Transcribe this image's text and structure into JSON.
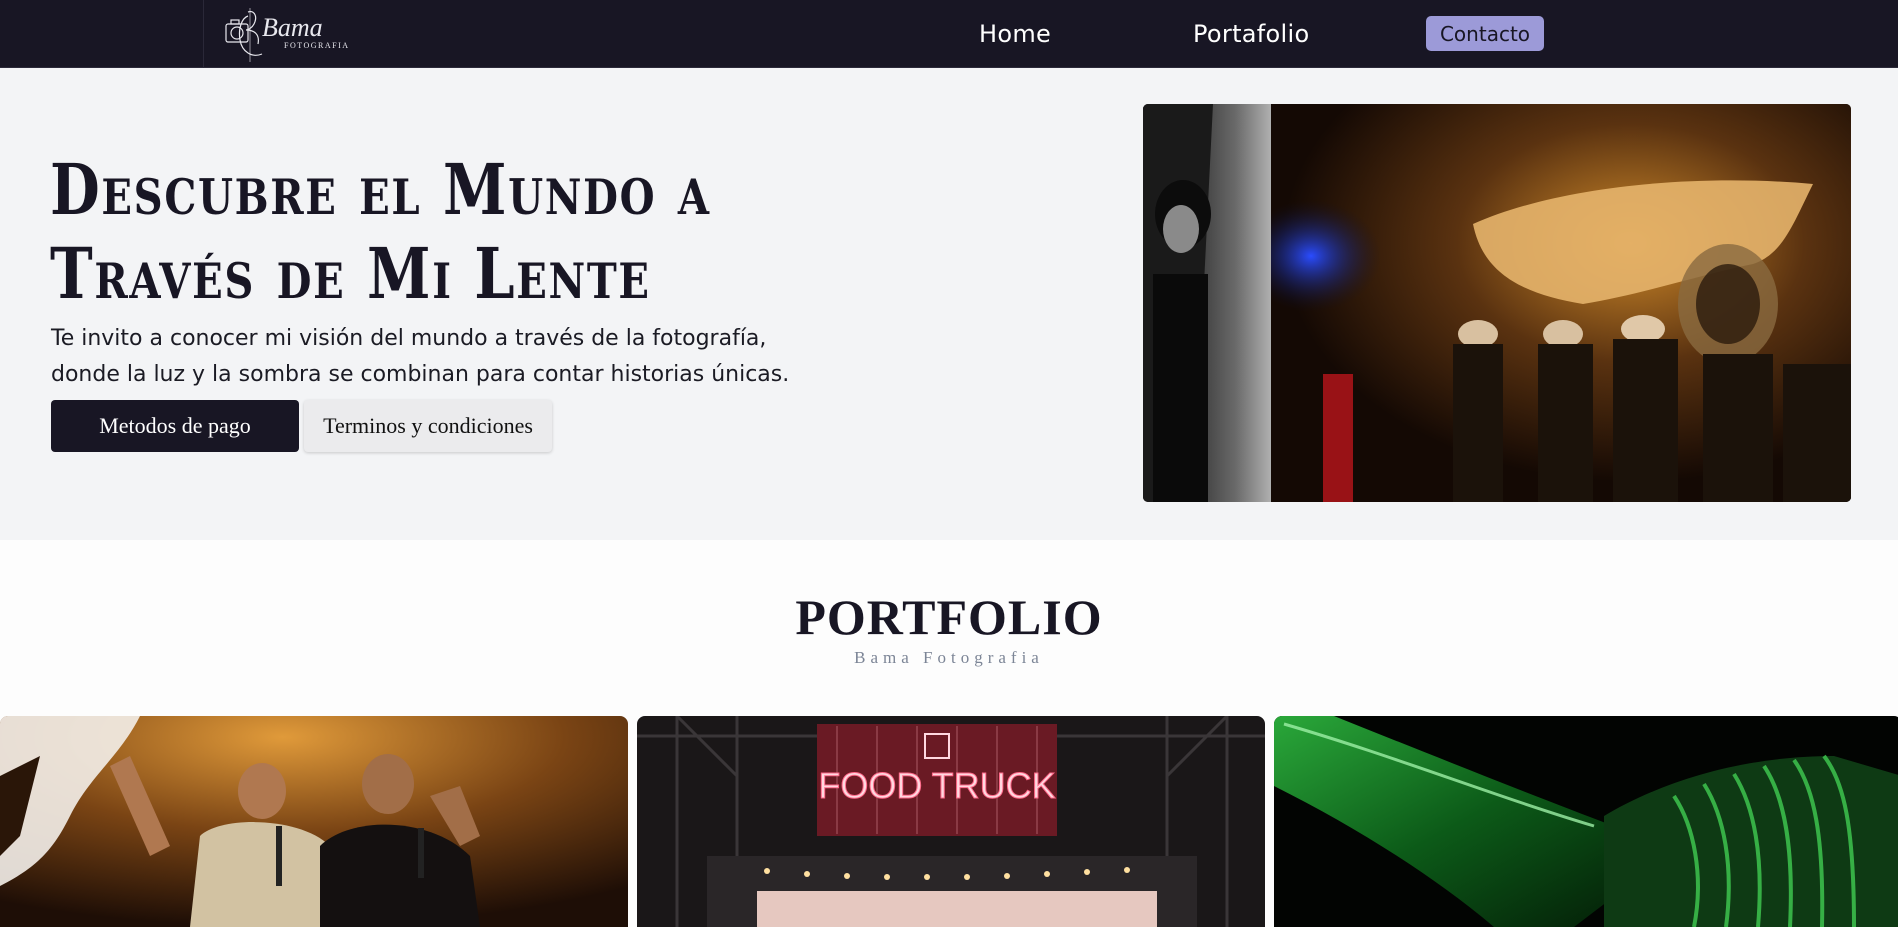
{
  "navbar": {
    "logo_text": "Bama",
    "logo_subtext": "FOTOGRAFIA",
    "links": [
      {
        "label": "Home"
      },
      {
        "label": "Portafolio"
      }
    ],
    "contact_label": "Contacto"
  },
  "hero": {
    "title": "Descubre el Mundo a Través de Mi Lente",
    "text": "Te invito a conocer mi visión del mundo a través de la fotografía, donde la luz y la sombra se combinan para contar historias únicas.",
    "buttons": {
      "primary": "Metodos de pago",
      "secondary": "Terminos y condiciones"
    },
    "photo_icon": "hero-photo"
  },
  "portfolio": {
    "title": "PORTFOLIO",
    "subtitle": "Bama Fotografia",
    "cards": [
      {
        "icon": "concert-photo"
      },
      {
        "icon": "food-truck-photo",
        "sign_text": "FOOD  TRUCK"
      },
      {
        "icon": "green-bottle-photo"
      }
    ]
  },
  "colors": {
    "navbar_bg": "#181624",
    "accent": "#9c9ad8",
    "hero_bg": "#f3f4f6",
    "text_dark": "#181624"
  }
}
